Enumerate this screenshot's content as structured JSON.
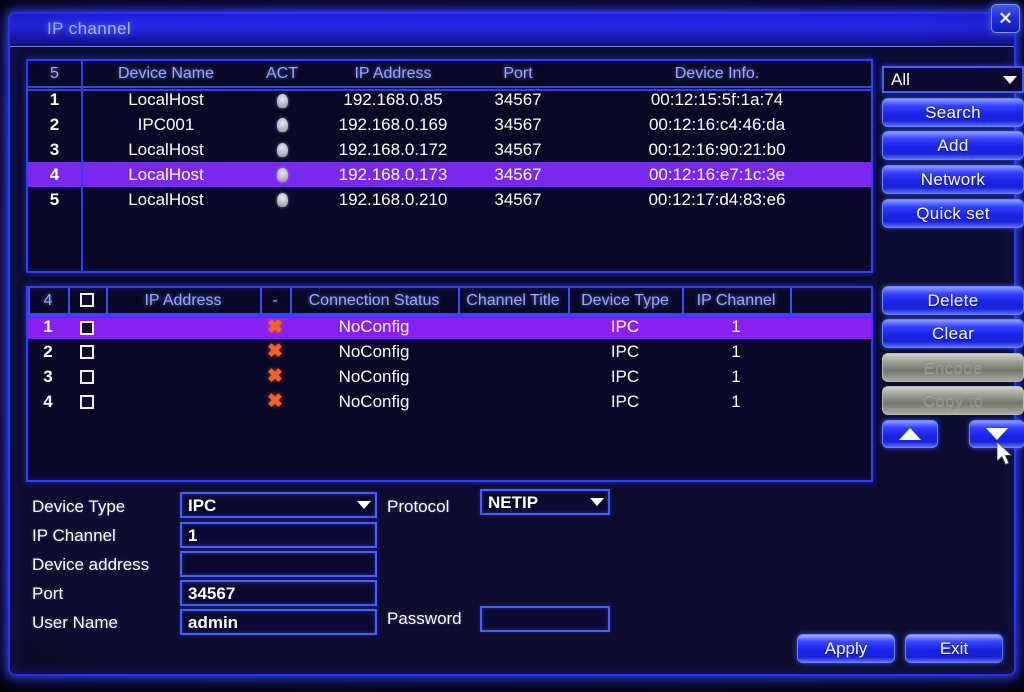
{
  "window": {
    "title": "IP channel",
    "close_icon": "close-icon"
  },
  "colors": {
    "accent": "#2f3dff",
    "selection_top": "#7a27f0",
    "selection_mid": "#8a1ff2",
    "error_x": "#f4622a",
    "title_text": "#a9b6ff"
  },
  "device_table": {
    "count_label": "5",
    "headers": [
      "Device Name",
      "ACT",
      "IP Address",
      "Port",
      "Device Info."
    ],
    "rows": [
      {
        "index": "1",
        "device_name": "LocalHost",
        "act": "lamp-icon",
        "ip": "192.168.0.85",
        "port": "34567",
        "info": "00:12:15:5f:1a:74",
        "selected": false
      },
      {
        "index": "2",
        "device_name": "IPC001",
        "act": "lamp-icon",
        "ip": "192.168.0.169",
        "port": "34567",
        "info": "00:12:16:c4:46:da",
        "selected": false
      },
      {
        "index": "3",
        "device_name": "LocalHost",
        "act": "lamp-icon",
        "ip": "192.168.0.172",
        "port": "34567",
        "info": "00:12:16:90:21:b0",
        "selected": false
      },
      {
        "index": "4",
        "device_name": "LocalHost",
        "act": "lamp-icon",
        "ip": "192.168.0.173",
        "port": "34567",
        "info": "00:12:16:e7:1c:3e",
        "selected": true
      },
      {
        "index": "5",
        "device_name": "LocalHost",
        "act": "lamp-icon",
        "ip": "192.168.0.210",
        "port": "34567",
        "info": "00:12:17:d4:83:e6",
        "selected": false
      }
    ]
  },
  "channel_table": {
    "count_label": "4",
    "headers": [
      "IP Address",
      "-",
      "Connection Status",
      "Channel Title",
      "Device Type",
      "IP Channel"
    ],
    "rows": [
      {
        "index": "1",
        "checked": false,
        "ip": "",
        "status_icon": "x-icon",
        "status": "NoConfig",
        "channel_title": "",
        "device_type": "IPC",
        "ip_channel": "1",
        "selected": true
      },
      {
        "index": "2",
        "checked": false,
        "ip": "",
        "status_icon": "x-icon",
        "status": "NoConfig",
        "channel_title": "",
        "device_type": "IPC",
        "ip_channel": "1",
        "selected": false
      },
      {
        "index": "3",
        "checked": false,
        "ip": "",
        "status_icon": "x-icon",
        "status": "NoConfig",
        "channel_title": "",
        "device_type": "IPC",
        "ip_channel": "1",
        "selected": false
      },
      {
        "index": "4",
        "checked": false,
        "ip": "",
        "status_icon": "x-icon",
        "status": "NoConfig",
        "channel_title": "",
        "device_type": "IPC",
        "ip_channel": "1",
        "selected": false
      }
    ]
  },
  "side_panel": {
    "filter_value": "All",
    "filter_options": [
      "All"
    ],
    "search_label": "Search",
    "add_label": "Add",
    "network_label": "Network",
    "quick_set_label": "Quick set",
    "delete_label": "Delete",
    "clear_label": "Clear",
    "encode_label": "Encode",
    "copy_to_label": "Copy to",
    "up_icon": "arrow-up-icon",
    "down_icon": "arrow-down-icon"
  },
  "form": {
    "device_type_label": "Device Type",
    "device_type_value": "IPC",
    "protocol_label": "Protocol",
    "protocol_value": "NETIP",
    "ip_channel_label": "IP Channel",
    "ip_channel_value": "1",
    "device_address_label": "Device address",
    "device_address_value": "",
    "port_label": "Port",
    "port_value": "34567",
    "user_name_label": "User Name",
    "user_name_value": "admin",
    "password_label": "Password",
    "password_value": ""
  },
  "footer": {
    "apply_label": "Apply",
    "exit_label": "Exit"
  }
}
